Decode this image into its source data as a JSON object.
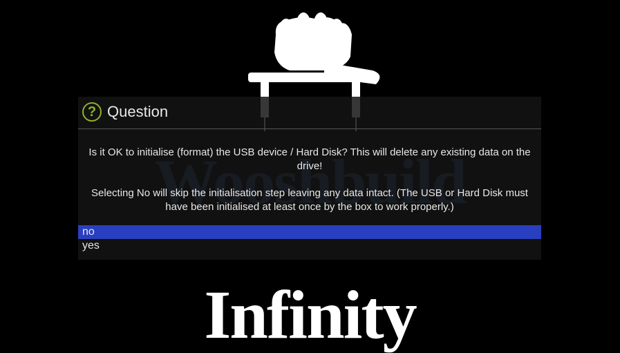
{
  "background": {
    "brand_top": "Wooshbuild",
    "brand_bottom": "Infinity"
  },
  "dialog": {
    "icon_name": "question-icon",
    "title": "Question",
    "message_line1": "Is it OK to initialise (format) the USB device / Hard Disk?  This will delete any existing data on the drive!",
    "message_line2": "Selecting No will skip the initialisation step leaving any data intact.  (The USB or Hard Disk must have been initialised at least once by the box to work properly.)",
    "options": {
      "no": "no",
      "yes": "yes"
    },
    "selected": "no"
  }
}
